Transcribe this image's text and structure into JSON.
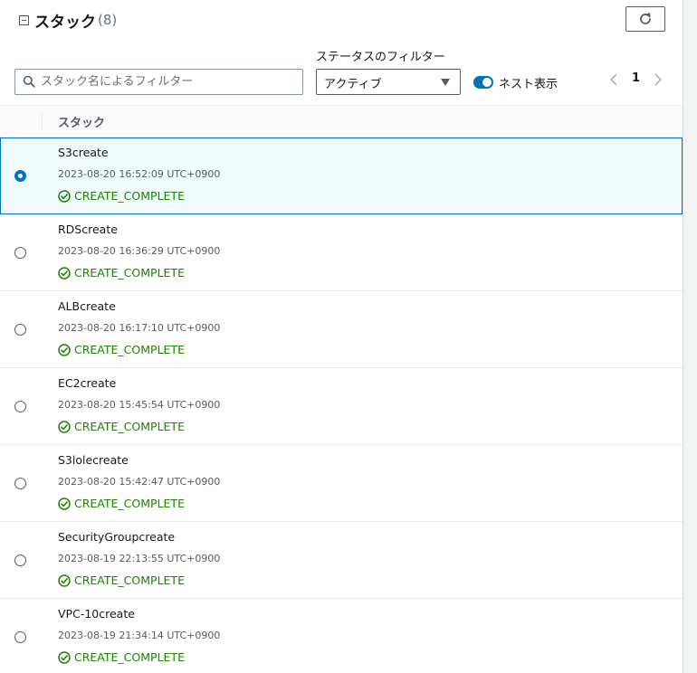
{
  "header": {
    "title": "スタック",
    "count": "(8)"
  },
  "filters": {
    "search_placeholder": "スタック名によるフィルター",
    "status_label": "ステータスのフィルター",
    "status_value": "アクティブ",
    "nested_label": "ネスト表示",
    "nested_on": true
  },
  "pagination": {
    "page": "1"
  },
  "table": {
    "header": "スタック",
    "rows": [
      {
        "name": "S3create",
        "date": "2023-08-20 16:52:09 UTC+0900",
        "status": "CREATE_COMPLETE",
        "selected": true
      },
      {
        "name": "RDScreate",
        "date": "2023-08-20 16:36:29 UTC+0900",
        "status": "CREATE_COMPLETE",
        "selected": false
      },
      {
        "name": "ALBcreate",
        "date": "2023-08-20 16:17:10 UTC+0900",
        "status": "CREATE_COMPLETE",
        "selected": false
      },
      {
        "name": "EC2create",
        "date": "2023-08-20 15:45:54 UTC+0900",
        "status": "CREATE_COMPLETE",
        "selected": false
      },
      {
        "name": "S3lolecreate",
        "date": "2023-08-20 15:42:47 UTC+0900",
        "status": "CREATE_COMPLETE",
        "selected": false
      },
      {
        "name": "SecurityGroupcreate",
        "date": "2023-08-19 22:13:55 UTC+0900",
        "status": "CREATE_COMPLETE",
        "selected": false
      },
      {
        "name": "VPC-10create",
        "date": "2023-08-19 21:34:14 UTC+0900",
        "status": "CREATE_COMPLETE",
        "selected": false
      }
    ]
  },
  "colors": {
    "accent": "#0073bb",
    "success": "#1d8102",
    "selected_bg": "#f1faff"
  },
  "icons": {
    "collapse": "minus-square-icon",
    "refresh": "refresh-icon",
    "search": "search-icon",
    "status": "check-circle-icon",
    "prev": "chevron-left-icon",
    "next": "chevron-right-icon"
  }
}
